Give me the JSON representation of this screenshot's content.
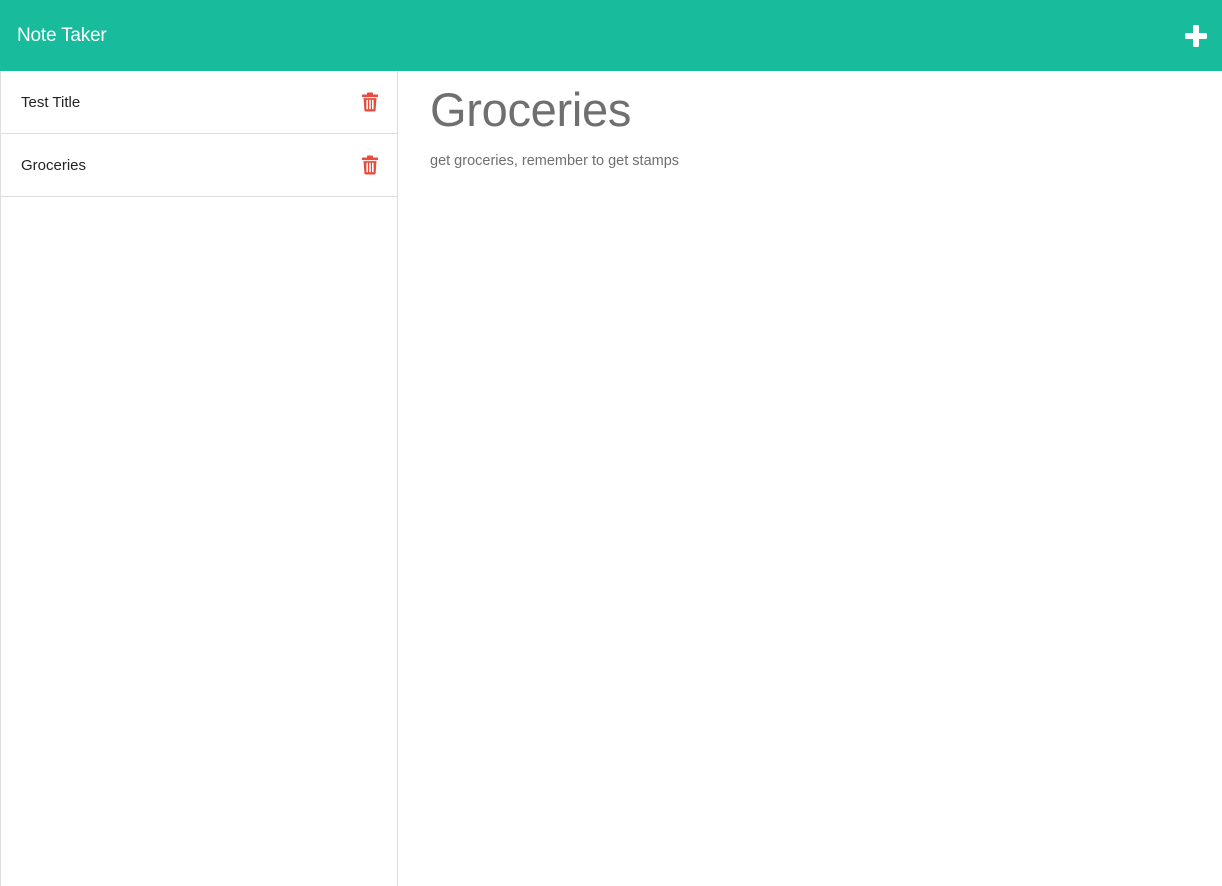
{
  "app": {
    "title": "Note Taker",
    "accent_color": "#18bc9c",
    "add_icon": "plus-icon"
  },
  "sidebar": {
    "notes": [
      {
        "label": "Test Title",
        "delete_icon": "trash-icon"
      },
      {
        "label": "Groceries",
        "delete_icon": "trash-icon"
      }
    ],
    "delete_color": "#e74c3c"
  },
  "main": {
    "title": "Groceries",
    "body": "get groceries, remember to get stamps"
  }
}
